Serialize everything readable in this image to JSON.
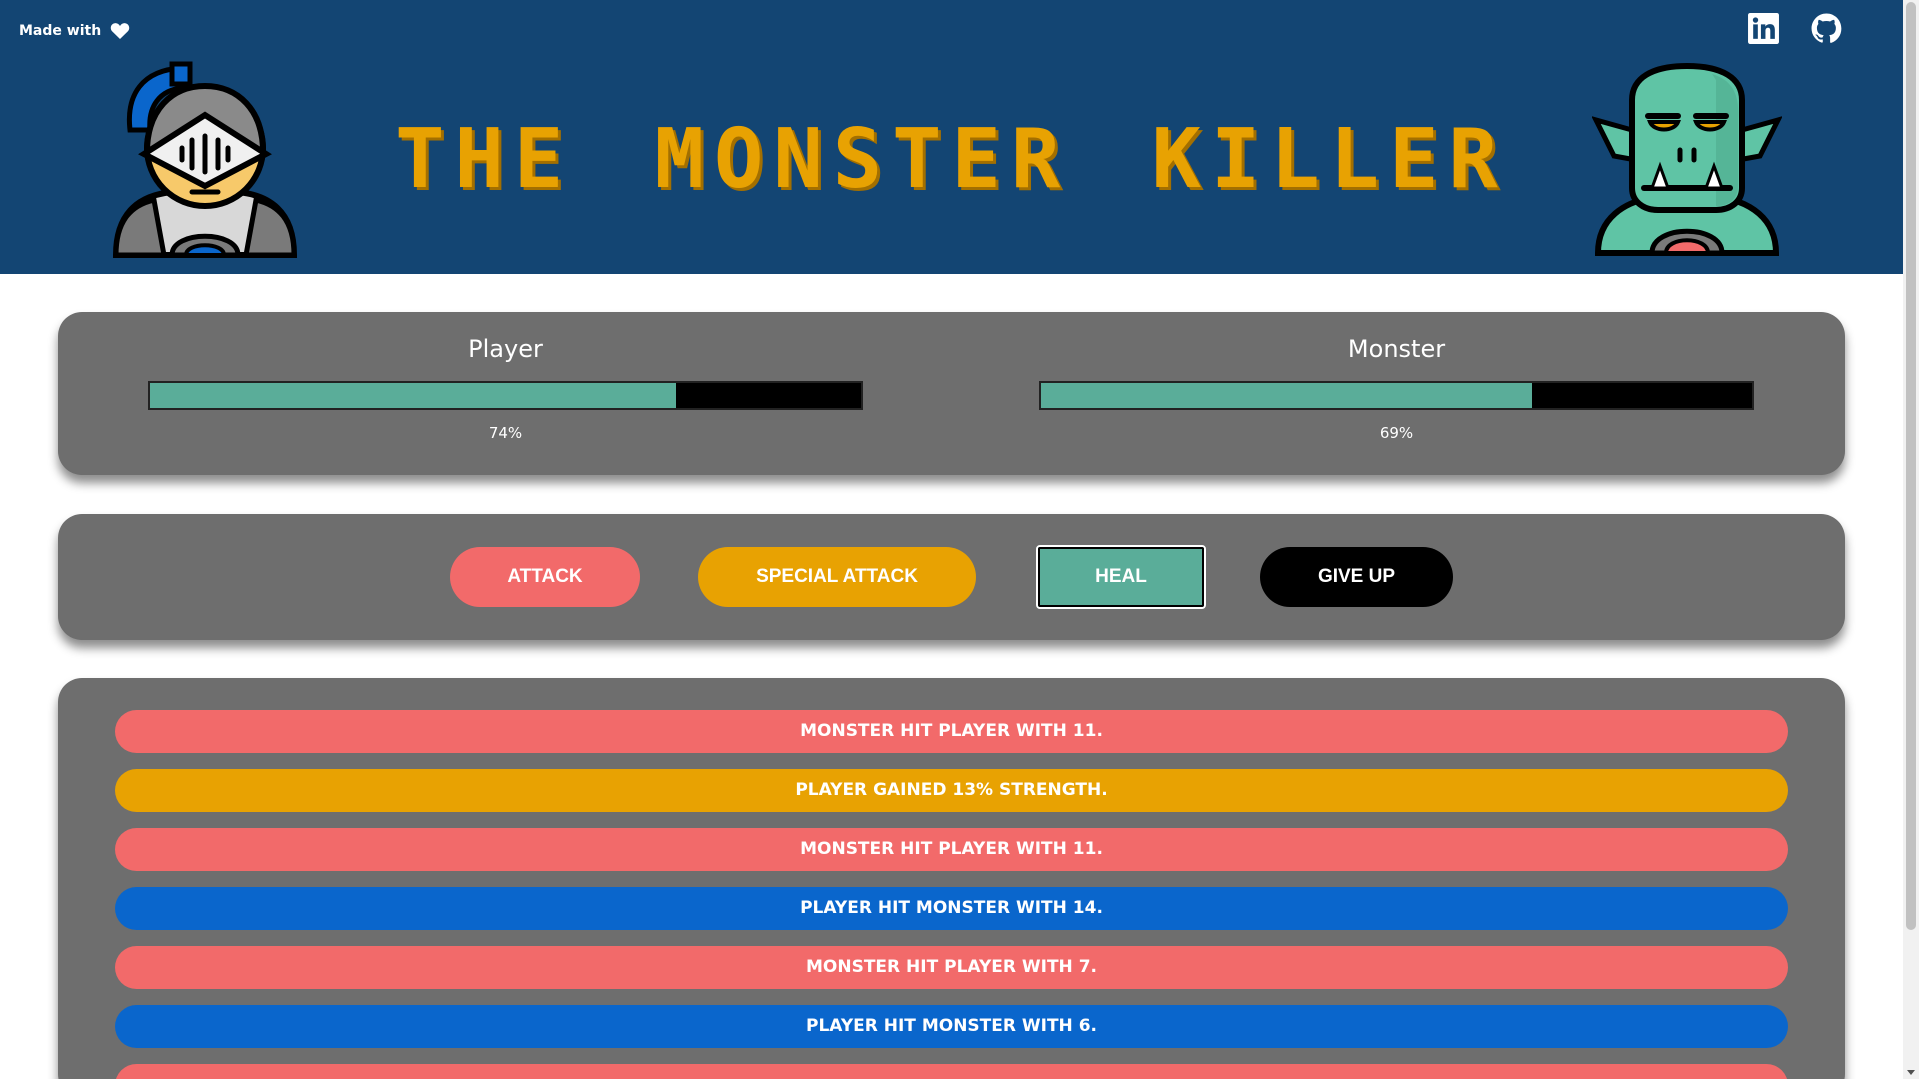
{
  "header": {
    "made_with": "Made with",
    "title": "THE MONSTER KILLER",
    "icons": {
      "heart": "heart-icon",
      "linkedin": "linkedin-icon",
      "github": "github-icon",
      "player_avatar": "knight-icon",
      "monster_avatar": "orc-icon"
    }
  },
  "health": {
    "player": {
      "name": "Player",
      "value": 74,
      "label": "74%"
    },
    "monster": {
      "name": "Monster",
      "value": 69,
      "label": "69%"
    }
  },
  "controls": {
    "attack": "ATTACK",
    "special_attack": "SPECIAL ATTACK",
    "heal": "HEAL",
    "give_up": "GIVE UP"
  },
  "log": [
    {
      "text": "MONSTER HIT PLAYER WITH 11.",
      "type": "monster",
      "color": "#f26a6a"
    },
    {
      "text": "PLAYER GAINED 13% STRENGTH.",
      "type": "heal",
      "color": "#e8a202"
    },
    {
      "text": "MONSTER HIT PLAYER WITH 11.",
      "type": "monster",
      "color": "#f26a6a"
    },
    {
      "text": "PLAYER HIT MONSTER WITH 14.",
      "type": "player",
      "color": "#0a66cc"
    },
    {
      "text": "MONSTER HIT PLAYER WITH 7.",
      "type": "monster",
      "color": "#f26a6a"
    },
    {
      "text": "PLAYER HIT MONSTER WITH 6.",
      "type": "player",
      "color": "#0a66cc"
    },
    {
      "text": "",
      "type": "monster",
      "color": "#f26a6a"
    }
  ],
  "colors": {
    "header_bg": "#134573",
    "title": "#e8a202",
    "card_bg": "#6e6e6e",
    "health_fill": "#5aad99",
    "attack": "#f26a6a",
    "special": "#e8a202",
    "heal": "#5aad99",
    "give_up": "#000000",
    "player_hit": "#0a66cc"
  }
}
